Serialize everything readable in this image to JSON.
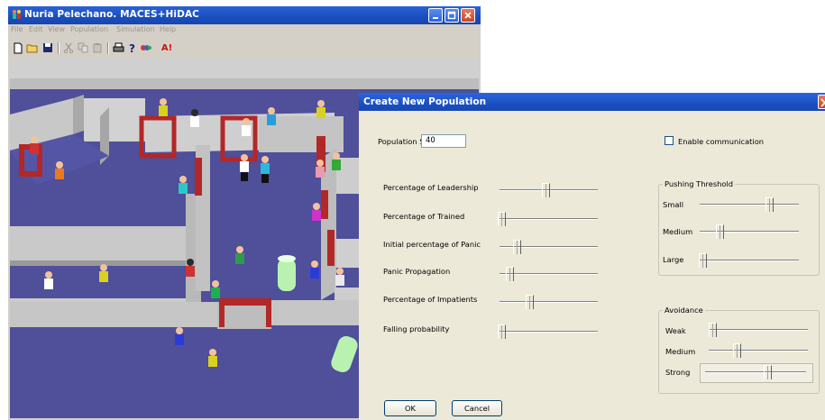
{
  "main_window": {
    "title": "Nuria Pelechano. MACES+HiDAC",
    "menu": [
      "File",
      "Edit",
      "View",
      "Population",
      "Simulation",
      "Help"
    ],
    "toolbar_icons": [
      "new-file-icon",
      "open-folder-icon",
      "save-icon",
      "cut-icon",
      "copy-icon",
      "paste-icon",
      "print-icon",
      "help-icon",
      "color-icon",
      "about-icon"
    ],
    "about_label": "A!"
  },
  "dialog": {
    "title": "Create New Population",
    "population_size_label": "Population Size:",
    "population_size_value": "40",
    "enable_communication_label": "Enable communication",
    "enable_communication_checked": false,
    "sliders": [
      {
        "label": "Percentage of Leadership",
        "value": 0.47
      },
      {
        "label": "Percentage of Trained",
        "value": 0.02
      },
      {
        "label": "Initial percentage of Panic",
        "value": 0.17
      },
      {
        "label": "Panic Propagation",
        "value": 0.1
      },
      {
        "label": "Percentage of Impatients",
        "value": 0.3
      },
      {
        "label": "Falling probability",
        "value": 0.02
      }
    ],
    "pushing_threshold": {
      "title": "Pushing Threshold",
      "items": [
        {
          "label": "Small",
          "value": 0.7
        },
        {
          "label": "Medium",
          "value": 0.2
        },
        {
          "label": "Large",
          "value": 0.03
        }
      ]
    },
    "avoidance": {
      "title": "Avoidance",
      "items": [
        {
          "label": "Weak",
          "value": 0.04
        },
        {
          "label": "Medium",
          "value": 0.28
        },
        {
          "label": "Strong",
          "value": 0.62
        }
      ]
    },
    "ok_label": "OK",
    "cancel_label": "Cancel"
  },
  "colors": {
    "titlebar_blue": "#1b4fc0",
    "floor_blue": "#4f4f9a",
    "wall_gray": "#c9c9c9",
    "door_red": "#b22828",
    "dialog_bg": "#ece9d8"
  }
}
